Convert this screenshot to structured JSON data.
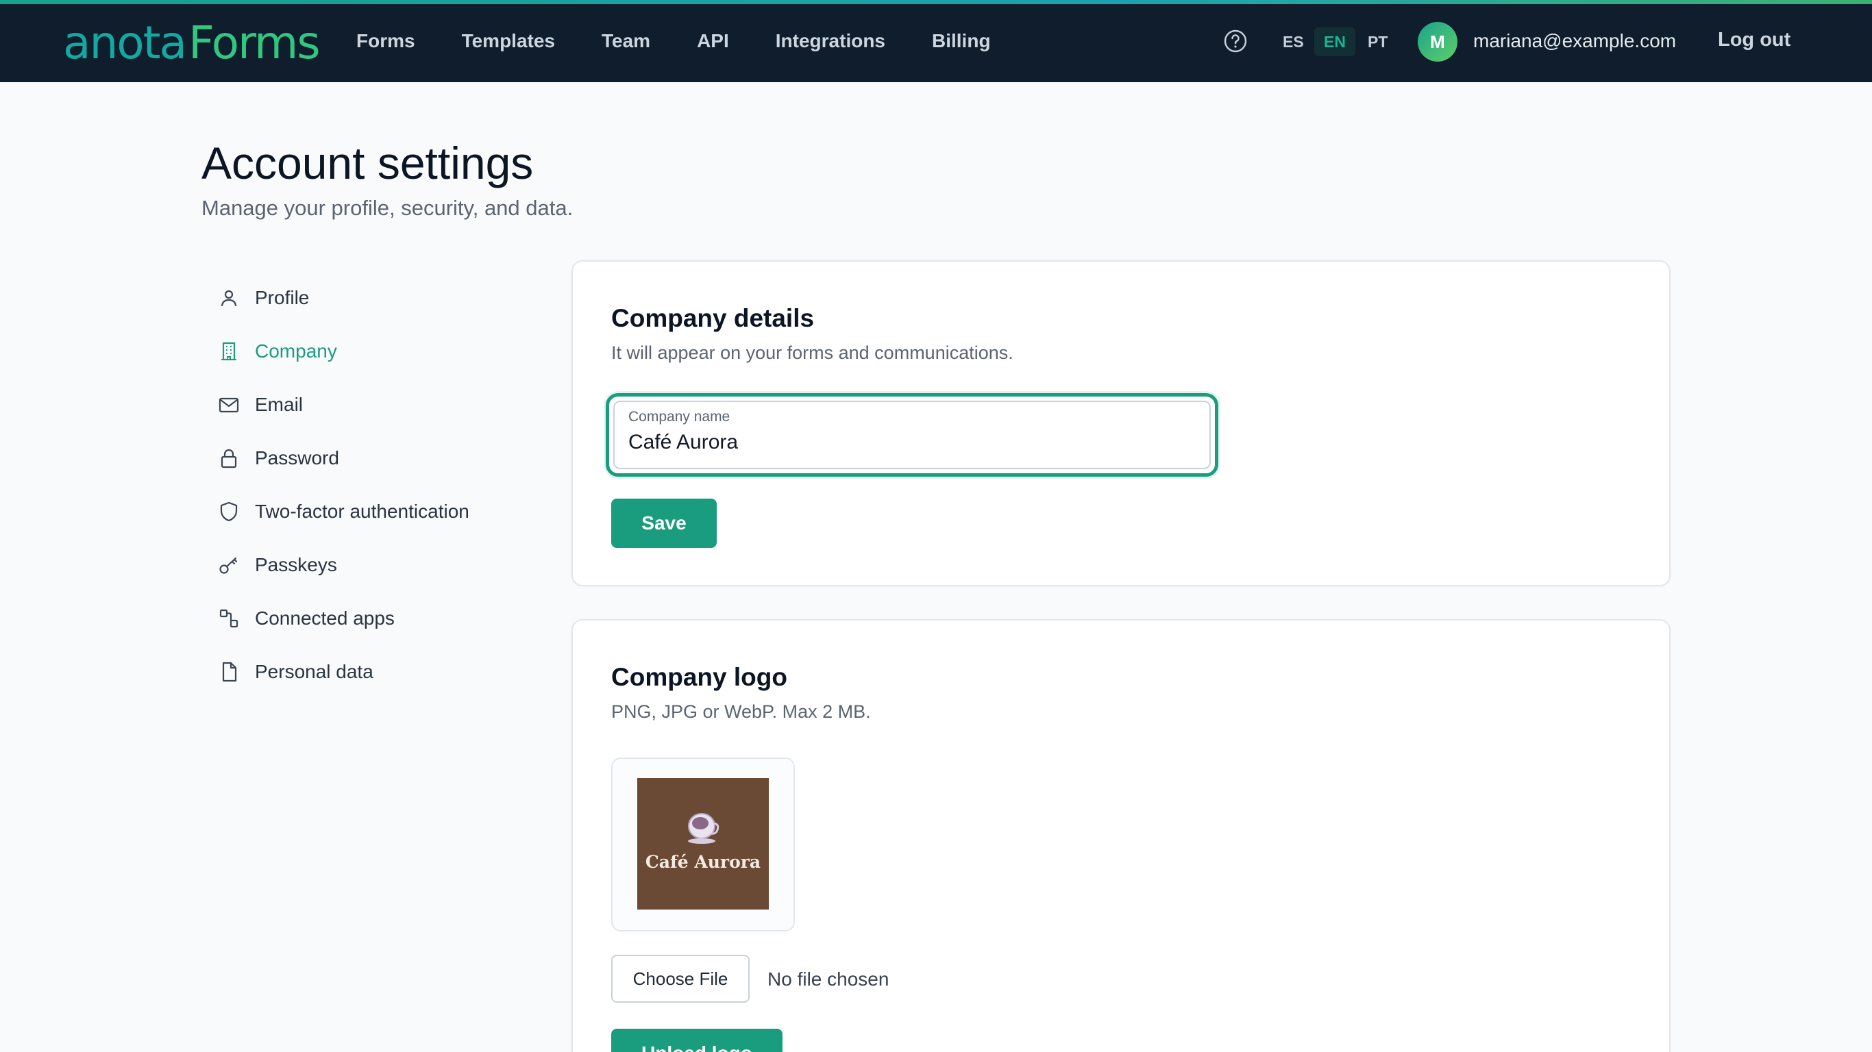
{
  "header": {
    "logo": {
      "part1": "anota",
      "part2": "Forms"
    },
    "nav": [
      "Forms",
      "Templates",
      "Team",
      "API",
      "Integrations",
      "Billing"
    ],
    "help_icon": "question-circle-icon",
    "languages": [
      "ES",
      "EN",
      "PT"
    ],
    "active_language": "EN",
    "user": {
      "avatar_initial": "M",
      "email": "mariana@example.com"
    },
    "logout_label": "Log out"
  },
  "page": {
    "title": "Account settings",
    "subtitle": "Manage your profile, security, and data."
  },
  "sidebar": {
    "items": [
      {
        "label": "Profile",
        "icon": "user-icon"
      },
      {
        "label": "Company",
        "icon": "building-icon",
        "active": true
      },
      {
        "label": "Email",
        "icon": "mail-icon"
      },
      {
        "label": "Password",
        "icon": "lock-icon"
      },
      {
        "label": "Two-factor authentication",
        "icon": "shield-icon"
      },
      {
        "label": "Passkeys",
        "icon": "key-icon"
      },
      {
        "label": "Connected apps",
        "icon": "connected-apps-icon"
      },
      {
        "label": "Personal data",
        "icon": "file-icon"
      }
    ]
  },
  "company_details": {
    "title": "Company details",
    "description": "It will appear on your forms and communications.",
    "field_label": "Company name",
    "field_value": "Café Aurora",
    "save_label": "Save"
  },
  "company_logo": {
    "title": "Company logo",
    "description": "PNG, JPG or WebP. Max 2 MB.",
    "preview_text": "Café Aurora",
    "choose_file_label": "Choose File",
    "no_file_label": "No file chosen",
    "upload_label": "Upload logo"
  },
  "colors": {
    "accent": "#1a9d7f",
    "header_bg": "#0f1d2c",
    "page_bg": "#f8fafb",
    "logo_bg": "#6b4a35"
  }
}
